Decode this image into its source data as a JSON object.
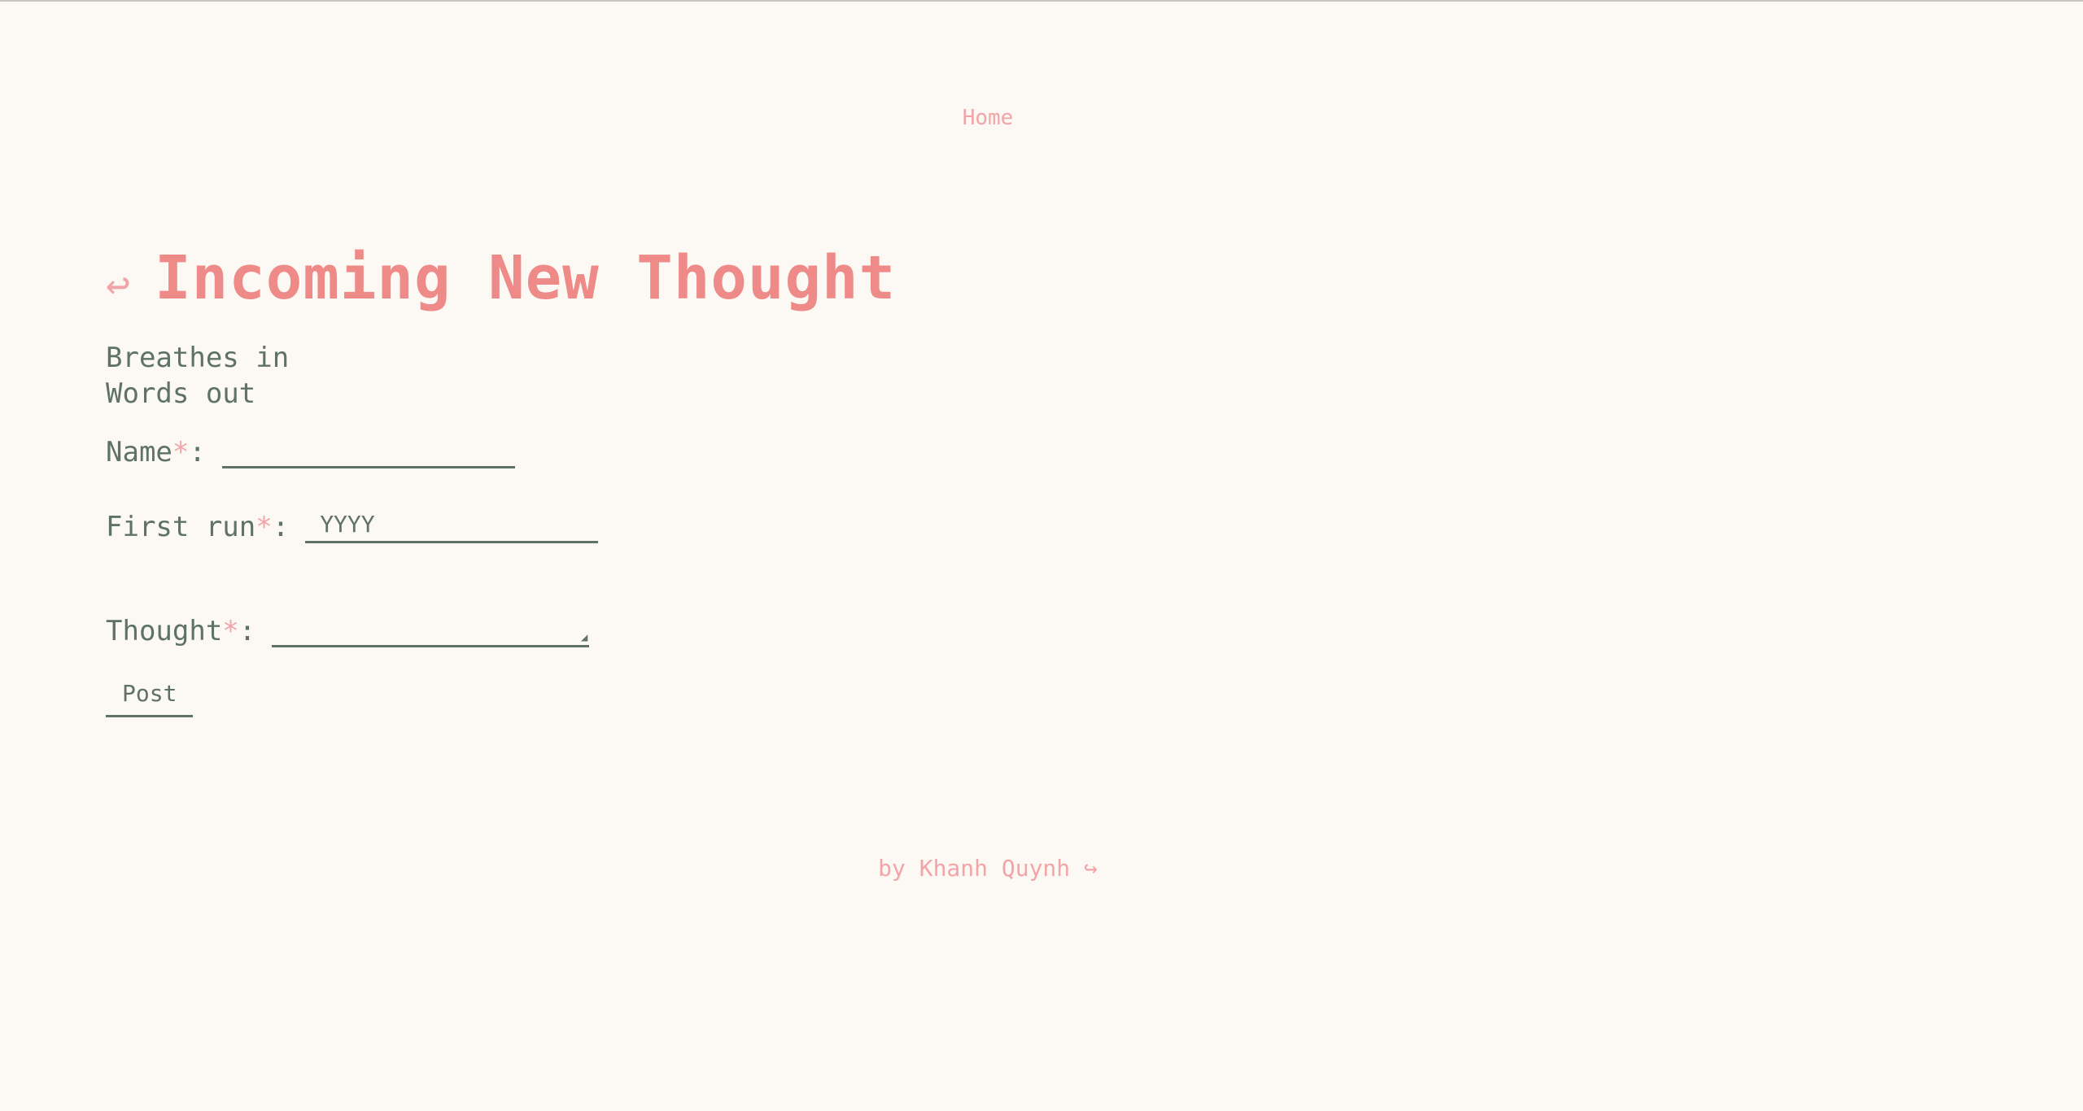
{
  "nav": {
    "home_label": "Home"
  },
  "header": {
    "back_icon": "↩",
    "title": "Incoming New Thought"
  },
  "tagline": {
    "line1": "Breathes in",
    "line2": "Words out"
  },
  "form": {
    "name_label": "Name",
    "name_value": "",
    "first_run_label": "First run",
    "first_run_placeholder": "YYYY",
    "thought_label": "Thought",
    "required_marker": "*",
    "separator": ":",
    "post_label": "Post"
  },
  "footer": {
    "text": "by Khanh Quynh ↪"
  },
  "colors": {
    "background": "#fcf8f3",
    "accent": "#ee8a87",
    "accent_light": "#f2a5a8",
    "text": "#5f7266"
  }
}
